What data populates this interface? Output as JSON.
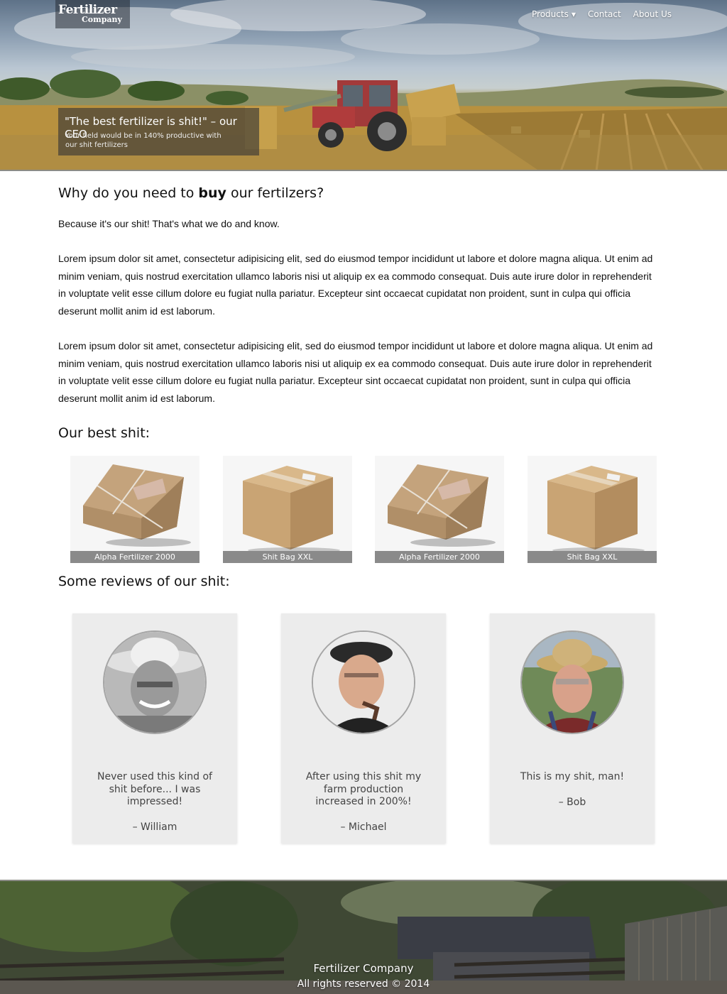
{
  "brand": {
    "logo_line1": "Fertilizer",
    "logo_line2": "Company"
  },
  "nav": {
    "items": [
      {
        "label": "Products",
        "has_dropdown": true
      },
      {
        "label": "Contact"
      },
      {
        "label": "About Us"
      }
    ]
  },
  "hero": {
    "quote": "\"The best fertilizer is shit!\" – our CEO",
    "subtext": "Your field would be in 140% productive with our shit fertilizers"
  },
  "intro": {
    "heading_before": "Why do you need to ",
    "heading_bold": "buy",
    "heading_after": " our fertilzers?",
    "tagline": "Because it's our shit! That's what we do and know.",
    "paragraphs": [
      "Lorem ipsum dolor sit amet, consectetur adipisicing elit, sed do eiusmod tempor incididunt ut labore et dolore magna aliqua. Ut enim ad minim veniam, quis nostrud exercitation ullamco laboris nisi ut aliquip ex ea commodo consequat. Duis aute irure dolor in reprehenderit in voluptate velit esse cillum dolore eu fugiat nulla pariatur. Excepteur sint occaecat cupidatat non proident, sunt in culpa qui officia deserunt mollit anim id est laborum.",
      "Lorem ipsum dolor sit amet, consectetur adipisicing elit, sed do eiusmod tempor incididunt ut labore et dolore magna aliqua. Ut enim ad minim veniam, quis nostrud exercitation ullamco laboris nisi ut aliquip ex ea commodo consequat. Duis aute irure dolor in reprehenderit in voluptate velit esse cillum dolore eu fugiat nulla pariatur. Excepteur sint occaecat cupidatat non proident, sunt in culpa qui officia deserunt mollit anim id est laborum."
    ]
  },
  "products": {
    "heading": "Our best shit:",
    "items": [
      {
        "label": "Alpha Fertilizer 2000",
        "icon": "parcel-icon"
      },
      {
        "label": "Shit Bag XXL",
        "icon": "box-icon"
      },
      {
        "label": "Alpha Fertilizer 2000",
        "icon": "parcel-icon"
      },
      {
        "label": "Shit Bag XXL",
        "icon": "box-icon"
      }
    ]
  },
  "reviews": {
    "heading": "Some reviews of our shit:",
    "items": [
      {
        "text": "Never used this kind of shit before... I was impressed!",
        "author": "– William"
      },
      {
        "text": "After using this shit my farm production increased in 200%!",
        "author": "– Michael"
      },
      {
        "text": "This is my shit, man!",
        "author": "– Bob"
      }
    ]
  },
  "footer": {
    "company": "Fertilizer Company",
    "rights": "All rights reserved © 2014"
  },
  "colors": {
    "label_bg": "#8a8a8a",
    "card_bg": "#ececec",
    "hero_overlay": "#46413780"
  }
}
